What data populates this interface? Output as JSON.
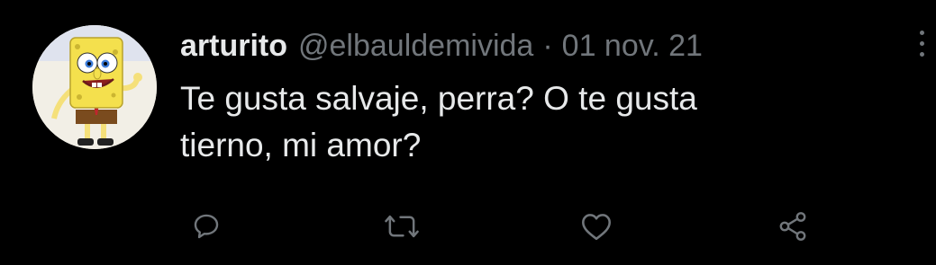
{
  "tweet": {
    "display_name": "arturito",
    "handle": "@elbauldemivida",
    "separator": "·",
    "date": "01 nov. 21",
    "text": "Te gusta salvaje, perra? O te gusta\ntierno, mi amor?"
  },
  "icons": {
    "avatar": "spongebob-avatar",
    "more": "more-options-icon",
    "reply": "reply-icon",
    "retweet": "retweet-icon",
    "like": "heart-icon",
    "share": "share-icon"
  },
  "colors": {
    "background": "#000000",
    "primary_text": "#e7e9ea",
    "secondary_text": "#71767b"
  }
}
